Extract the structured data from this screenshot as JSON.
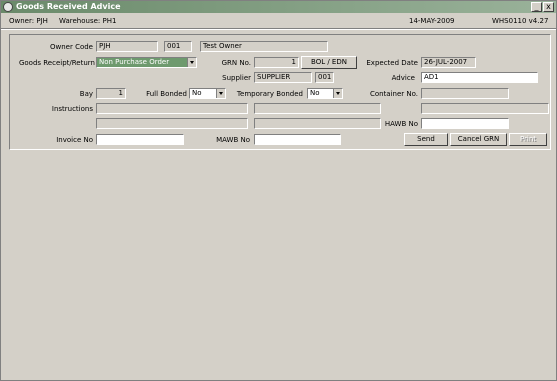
{
  "window": {
    "title": "Goods Received Advice",
    "minimize": "_",
    "close": "x"
  },
  "infobar": {
    "owner": "Owner: PJH",
    "warehouse": "Warehouse: PH1",
    "date": "14-MAY-2009",
    "version": "WHS0110  v4.27"
  },
  "form": {
    "owner_code_label": "Owner Code",
    "owner_code": "PJH",
    "owner_num": "001",
    "owner_name": "Test Owner",
    "receipt_label": "Goods Receipt/Return",
    "receipt_value": "Non Purchase Order",
    "grn_label": "GRN No.",
    "grn_value": "1",
    "bol_button": "BOL / EDN",
    "expected_label": "Expected Date",
    "expected_value": "26-JUL-2007",
    "supplier_label": "Supplier",
    "supplier_value": "SUPPLIER",
    "supplier_num": "001",
    "advice_label": "Advice",
    "advice_value": "AD1",
    "bay_label": "Bay",
    "bay_value": "1",
    "full_bonded_label": "Full Bonded",
    "full_bonded_value": "No",
    "temp_bonded_label": "Temporary Bonded",
    "temp_bonded_value": "No",
    "container_label": "Container No.",
    "container_value": "",
    "instructions_label": "Instructions",
    "hawb_label": "HAWB No",
    "hawb_value": "",
    "invoice_label": "Invoice No",
    "invoice_value": "",
    "mawb_label": "MAWB No",
    "mawb_value": ""
  },
  "buttons": {
    "send": "Send",
    "cancel_grn": "Cancel GRN",
    "print": "Print"
  }
}
